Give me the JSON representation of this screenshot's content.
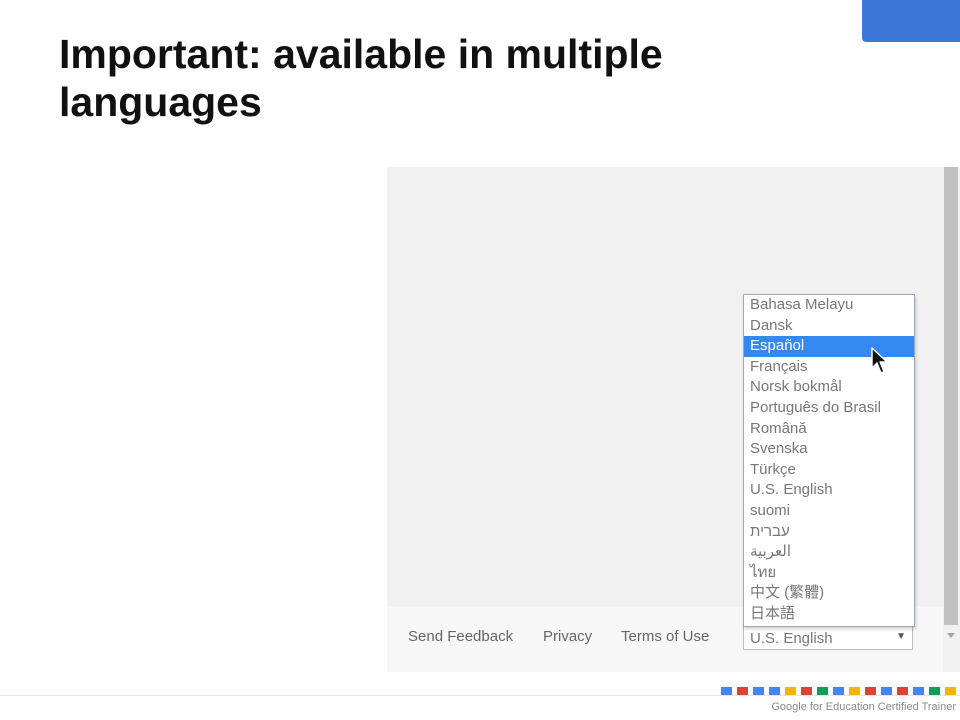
{
  "slide": {
    "title": "Important: available in multiple languages",
    "accent_color": "#3d78d8"
  },
  "screenshot": {
    "footer_links": [
      "Send Feedback",
      "Privacy",
      "Terms of Use"
    ],
    "language_select": {
      "value": "U.S. English",
      "arrow": "▼",
      "options": [
        "Bahasa Melayu",
        "Dansk",
        "Español",
        "Français",
        "Norsk bokmål",
        "Português do Brasil",
        "Română",
        "Svenska",
        "Türkçe",
        "U.S. English",
        "suomi",
        "עברית",
        "العربية",
        "ไทย",
        "中文 (繁體)",
        "日本語"
      ],
      "highlighted_option": "Español"
    },
    "cursor_icon": "arrow-pointer-icon"
  },
  "branding": {
    "text": "Google for Education Certified Trainer",
    "square_colors": [
      "#4285f4",
      "#db4437",
      "#4285f4",
      "#4285f4",
      "#f4b400",
      "#db4437",
      "#0f9d58",
      "#4285f4",
      "#f4b400",
      "#db4437",
      "#4285f4",
      "#db4437",
      "#4285f4",
      "#0f9d58",
      "#f4b400"
    ]
  }
}
